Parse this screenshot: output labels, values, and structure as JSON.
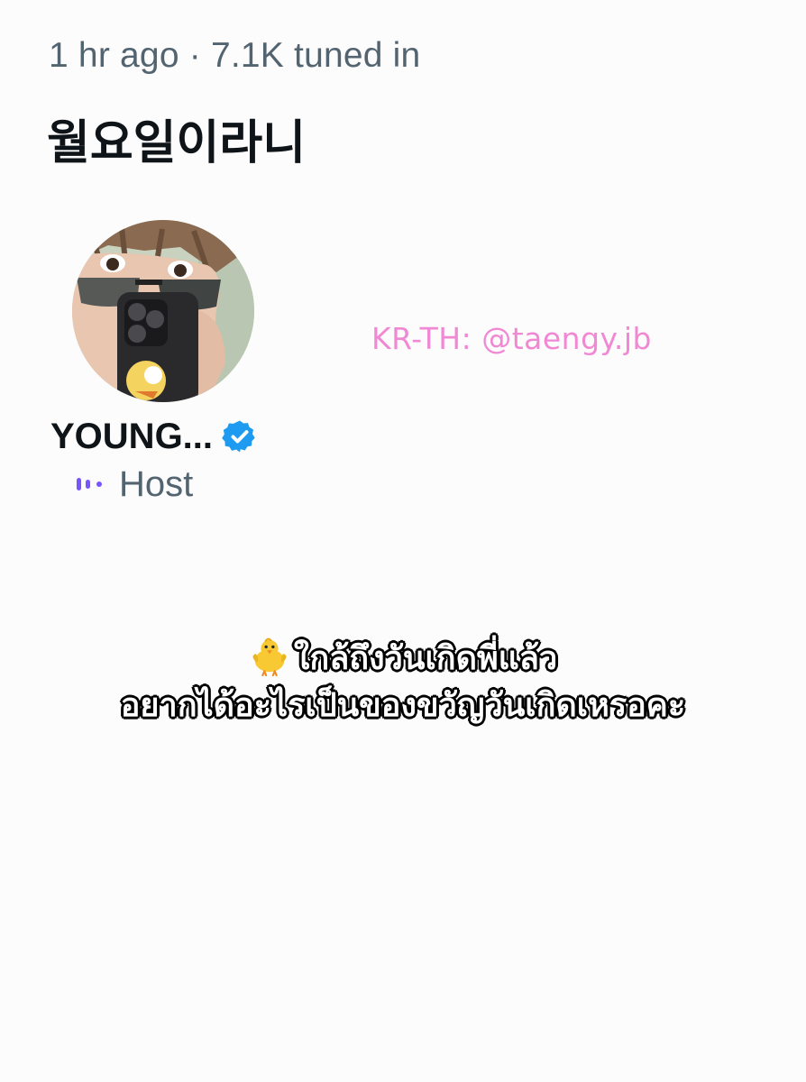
{
  "space": {
    "meta": "1 hr ago · 7.1K tuned in",
    "title": "월요일이라니"
  },
  "host": {
    "name": "YOUNG...",
    "role": "Host",
    "verified_color": "#1d9bf0",
    "speaking_icon_color": "#7856ff"
  },
  "credit": {
    "text": "KR-TH: @taengy.jb",
    "color": "#f088d4"
  },
  "caption": {
    "line1": "ใกล้ถึงวันเกิดพี่แล้ว",
    "line2": "อยากได้อะไรเป็นของขวัญวันเกิดเหรอคะ"
  },
  "icons": [
    "verified-badge-icon",
    "speaking-bars-icon",
    "baby-chick-icon"
  ]
}
